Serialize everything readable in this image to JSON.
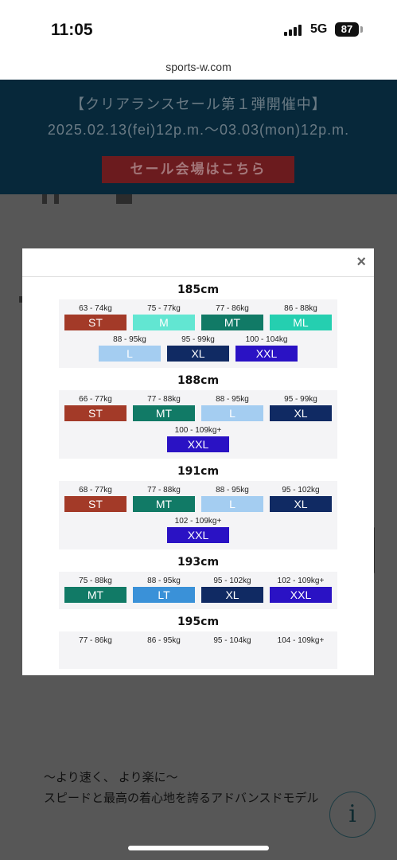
{
  "status_bar": {
    "time": "11:05",
    "network": "5G",
    "battery": "87"
  },
  "url": "sports-w.com",
  "promo": {
    "line1": "【クリアランスセール第１弾開催中】",
    "line2": "2025.02.13(fei)12p.m.～03.03(mon)12p.m.",
    "button": "セール会場はこちら"
  },
  "background_copy": {
    "line1": "〜より速く、 より楽に〜",
    "line2": "スピードと最高の着心地を誇るアドバンスドモデル"
  },
  "info_button": "i",
  "modal": {
    "close_label": "×"
  },
  "size_colors": {
    "ST": "#a33a28",
    "M": "#62e6d2",
    "MT": "#117a66",
    "ML": "#25cfb0",
    "L": "#a4cdf1",
    "LT": "#3a91d8",
    "XL": "#102a63",
    "XXL": "#2a12c4"
  },
  "chart_data": {
    "type": "table",
    "sections": [
      {
        "height": "185cm",
        "rows": [
          [
            {
              "weight": "63 - 74kg",
              "size": "ST"
            },
            {
              "weight": "75 - 77kg",
              "size": "M"
            },
            {
              "weight": "77 - 86kg",
              "size": "MT"
            },
            {
              "weight": "86 - 88kg",
              "size": "ML"
            }
          ],
          [
            {
              "weight": "88 - 95kg",
              "size": "L"
            },
            {
              "weight": "95 - 99kg",
              "size": "XL"
            },
            {
              "weight": "100 - 104kg",
              "size": "XXL"
            }
          ]
        ]
      },
      {
        "height": "188cm",
        "rows": [
          [
            {
              "weight": "66 - 77kg",
              "size": "ST"
            },
            {
              "weight": "77 - 88kg",
              "size": "MT"
            },
            {
              "weight": "88 - 95kg",
              "size": "L"
            },
            {
              "weight": "95 - 99kg",
              "size": "XL"
            }
          ],
          [
            {
              "weight": "100 - 109kg+",
              "size": "XXL"
            }
          ]
        ]
      },
      {
        "height": "191cm",
        "rows": [
          [
            {
              "weight": "68 - 77kg",
              "size": "ST"
            },
            {
              "weight": "77 - 88kg",
              "size": "MT"
            },
            {
              "weight": "88 - 95kg",
              "size": "L"
            },
            {
              "weight": "95 - 102kg",
              "size": "XL"
            }
          ],
          [
            {
              "weight": "102 - 109kg+",
              "size": "XXL"
            }
          ]
        ]
      },
      {
        "height": "193cm",
        "rows": [
          [
            {
              "weight": "75 - 88kg",
              "size": "MT"
            },
            {
              "weight": "88 - 95kg",
              "size": "LT"
            },
            {
              "weight": "95 - 102kg",
              "size": "XL"
            },
            {
              "weight": "102 - 109kg+",
              "size": "XXL"
            }
          ]
        ]
      },
      {
        "height": "195cm",
        "rows": [
          [
            {
              "weight": "77 - 86kg",
              "size": ""
            },
            {
              "weight": "86 - 95kg",
              "size": ""
            },
            {
              "weight": "95 - 104kg",
              "size": ""
            },
            {
              "weight": "104 - 109kg+",
              "size": ""
            }
          ]
        ]
      }
    ]
  }
}
